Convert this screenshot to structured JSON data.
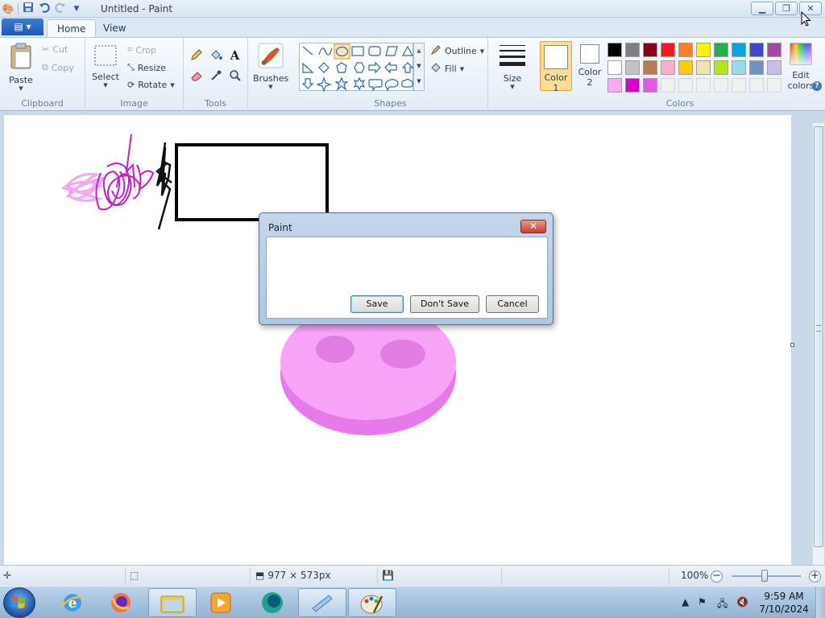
{
  "window": {
    "title": "Untitled - Paint",
    "controls": [
      "minimize",
      "restore",
      "close"
    ]
  },
  "quick_access": {
    "icons": [
      "paint-app-icon",
      "save-icon",
      "undo-icon",
      "redo-icon",
      "customize-icon"
    ]
  },
  "ribbon": {
    "file_tab_icon": "file-menu-icon",
    "tabs": [
      {
        "label": "Home",
        "active": true
      },
      {
        "label": "View",
        "active": false
      }
    ],
    "clipboard": {
      "group_label": "Clipboard",
      "paste_label": "Paste",
      "cut_label": "Cut",
      "copy_label": "Copy"
    },
    "image": {
      "group_label": "Image",
      "select_label": "Select",
      "crop_label": "Crop",
      "resize_label": "Resize",
      "rotate_label": "Rotate"
    },
    "tools": {
      "group_label": "Tools",
      "items": [
        "pencil-icon",
        "fill-icon",
        "text-icon",
        "eraser-icon",
        "color-picker-icon",
        "magnifier-icon"
      ],
      "text_glyph": "A"
    },
    "brushes": {
      "label": "Brushes"
    },
    "shapes": {
      "group_label": "Shapes",
      "outline_label": "Outline",
      "fill_label": "Fill",
      "selected_shape": "oval",
      "items": [
        "line",
        "curve",
        "oval",
        "rectangle",
        "rounded-rectangle",
        "polygon",
        "triangle",
        "right-triangle",
        "diamond",
        "pentagon",
        "hexagon",
        "right-arrow",
        "left-arrow",
        "up-arrow",
        "down-arrow",
        "four-point-star",
        "five-point-star",
        "six-point-star",
        "rounded-callout",
        "oval-callout",
        "cloud-callout"
      ]
    },
    "size": {
      "label": "Size"
    },
    "colors": {
      "group_label": "Colors",
      "color1_label": "Color",
      "color1_num": "1",
      "color1_value": "#ffffff",
      "color2_label": "Color",
      "color2_num": "2",
      "color2_value": "#ffffff",
      "edit_label_1": "Edit",
      "edit_label_2": "colors",
      "palette": [
        [
          "#000000",
          "#7f7f7f",
          "#880015",
          "#ed1c24",
          "#ff7f27",
          "#fff200",
          "#22b14c",
          "#00a2e8",
          "#3f48cc",
          "#a349a4"
        ],
        [
          "#ffffff",
          "#c3c3c3",
          "#b97a57",
          "#ffaec9",
          "#ffc90e",
          "#efe4b0",
          "#b5e61d",
          "#99d9ea",
          "#7092be",
          "#c8bfe7"
        ],
        [
          "#ffaaf0",
          "#d400c8",
          "#e45ae6",
          "#f0f0f0",
          "#f0f0f0",
          "#f0f0f0",
          "#f0f0f0",
          "#f0f0f0",
          "#f0f0f0",
          "#f0f0f0"
        ]
      ]
    }
  },
  "canvas": {
    "drawings": [
      "pink-scribble",
      "magenta-scribble",
      "black-scribble",
      "black-rectangle",
      "pink-3d-ellipse-with-two-holes"
    ]
  },
  "dialog": {
    "title": "Paint",
    "message": "",
    "close_glyph": "✕",
    "buttons": {
      "save": "Save",
      "dont_save": "Don't Save",
      "cancel": "Cancel"
    }
  },
  "statusbar": {
    "dimensions": "977 × 573px",
    "zoom": "100%",
    "zoom_level": 1.0
  },
  "taskbar": {
    "apps": [
      "internet-explorer",
      "firefox",
      "file-explorer",
      "media-player",
      "app-5",
      "image-viewer",
      "paint"
    ],
    "time": "9:59 AM",
    "date": "7/10/2024"
  }
}
